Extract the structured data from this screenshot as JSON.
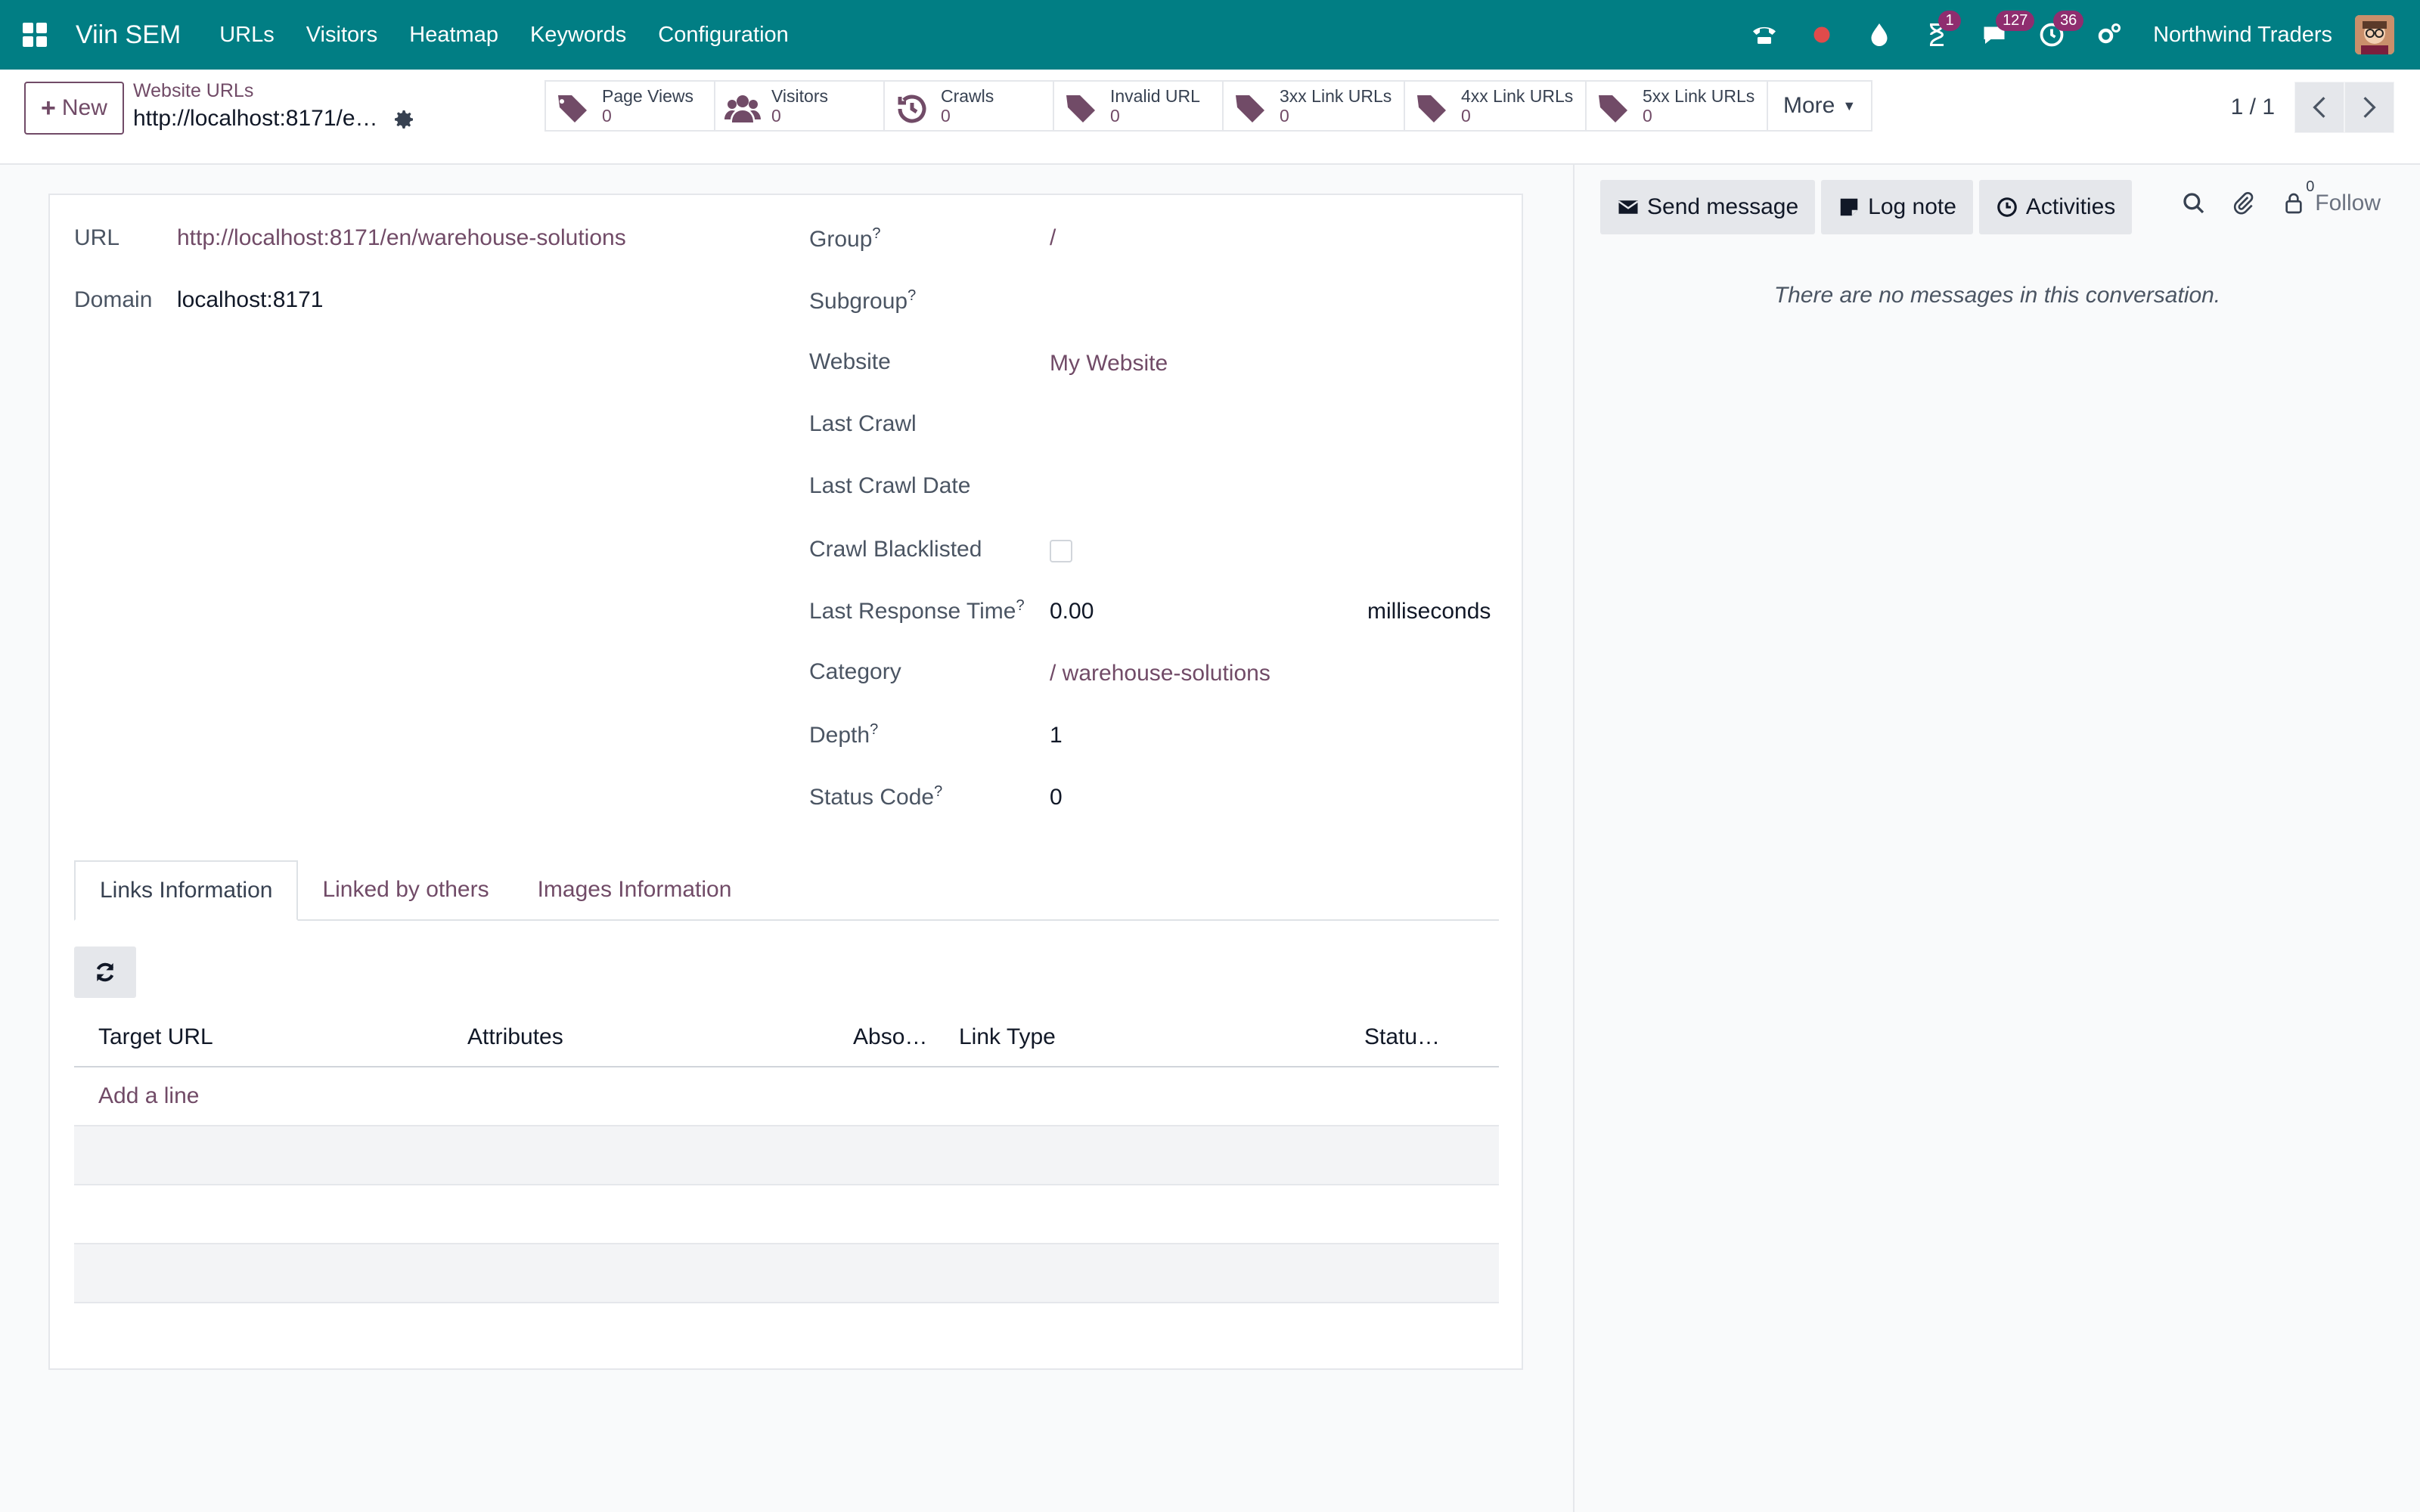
{
  "navbar": {
    "app_name": "Viin SEM",
    "menu": [
      {
        "label": "URLs"
      },
      {
        "label": "Visitors"
      },
      {
        "label": "Heatmap"
      },
      {
        "label": "Keywords"
      },
      {
        "label": "Configuration"
      }
    ],
    "activity_badge": "1",
    "messages_badge": "127",
    "clock_badge": "36",
    "company": "Northwind Traders"
  },
  "control": {
    "new_label": "New",
    "breadcrumb": "Website URLs",
    "record_name": "http://localhost:8171/e…",
    "stats": [
      {
        "label": "Page Views",
        "value": "0",
        "icon": "tags-icon"
      },
      {
        "label": "Visitors",
        "value": "0",
        "icon": "users-icon"
      },
      {
        "label": "Crawls",
        "value": "0",
        "icon": "history-icon"
      },
      {
        "label": "Invalid URL",
        "value": "0",
        "icon": "tags-icon"
      },
      {
        "label": "3xx Link URLs",
        "value": "0",
        "icon": "tags-icon"
      },
      {
        "label": "4xx Link URLs",
        "value": "0",
        "icon": "tags-icon"
      },
      {
        "label": "5xx Link URLs",
        "value": "0",
        "icon": "tags-icon"
      }
    ],
    "more_label": "More",
    "pager": "1 / 1"
  },
  "form": {
    "url_label": "URL",
    "url_value": "http://localhost:8171/en/warehouse-solutions",
    "domain_label": "Domain",
    "domain_value": "localhost:8171",
    "group_label": "Group",
    "group_value": "/",
    "subgroup_label": "Subgroup",
    "website_label": "Website",
    "website_value": "My Website",
    "last_crawl_label": "Last Crawl",
    "last_crawl_date_label": "Last Crawl Date",
    "crawl_blacklisted_label": "Crawl Blacklisted",
    "last_response_label": "Last Response Time",
    "last_response_value": "0.00",
    "last_response_unit": "milliseconds",
    "category_label": "Category",
    "category_value": "/ warehouse-solutions",
    "depth_label": "Depth",
    "depth_value": "1",
    "status_code_label": "Status Code",
    "status_code_value": "0",
    "help_mark": "?"
  },
  "tabs": [
    {
      "label": "Links Information"
    },
    {
      "label": "Linked by others"
    },
    {
      "label": "Images Information"
    }
  ],
  "table": {
    "headers": [
      "Target URL",
      "Attributes",
      "Abso…",
      "Link Type",
      "Statu…"
    ],
    "add_line": "Add a line"
  },
  "chatter": {
    "send_message": "Send message",
    "log_note": "Log note",
    "activities": "Activities",
    "follower_count": "0",
    "follow": "Follow",
    "empty": "There are no messages in this conversation."
  },
  "colors": {
    "navbar": "#017e84",
    "accent": "#714b67",
    "badge": "#8f2d6f"
  }
}
